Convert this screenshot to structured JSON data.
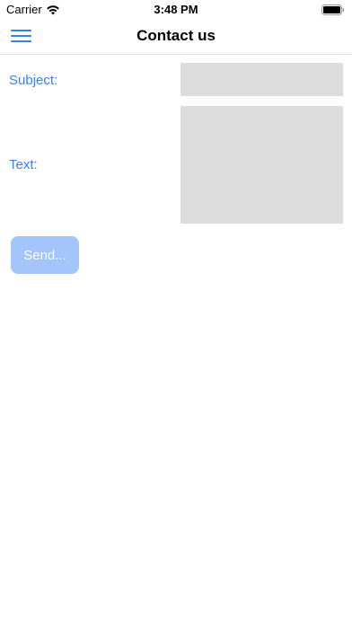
{
  "status_bar": {
    "carrier": "Carrier",
    "time": "3:48 PM",
    "wifi_icon": "wifi-icon",
    "battery_icon": "battery-icon"
  },
  "nav": {
    "title": "Contact us",
    "menu_icon": "hamburger-menu-icon"
  },
  "form": {
    "subject_label": "Subject:",
    "subject_value": "",
    "text_label": "Text:",
    "text_value": "",
    "send_label": "Send..."
  },
  "colors": {
    "accent": "#3b82e8",
    "field_background": "#dcdcdc",
    "send_button_disabled": "#a3c5fb"
  }
}
